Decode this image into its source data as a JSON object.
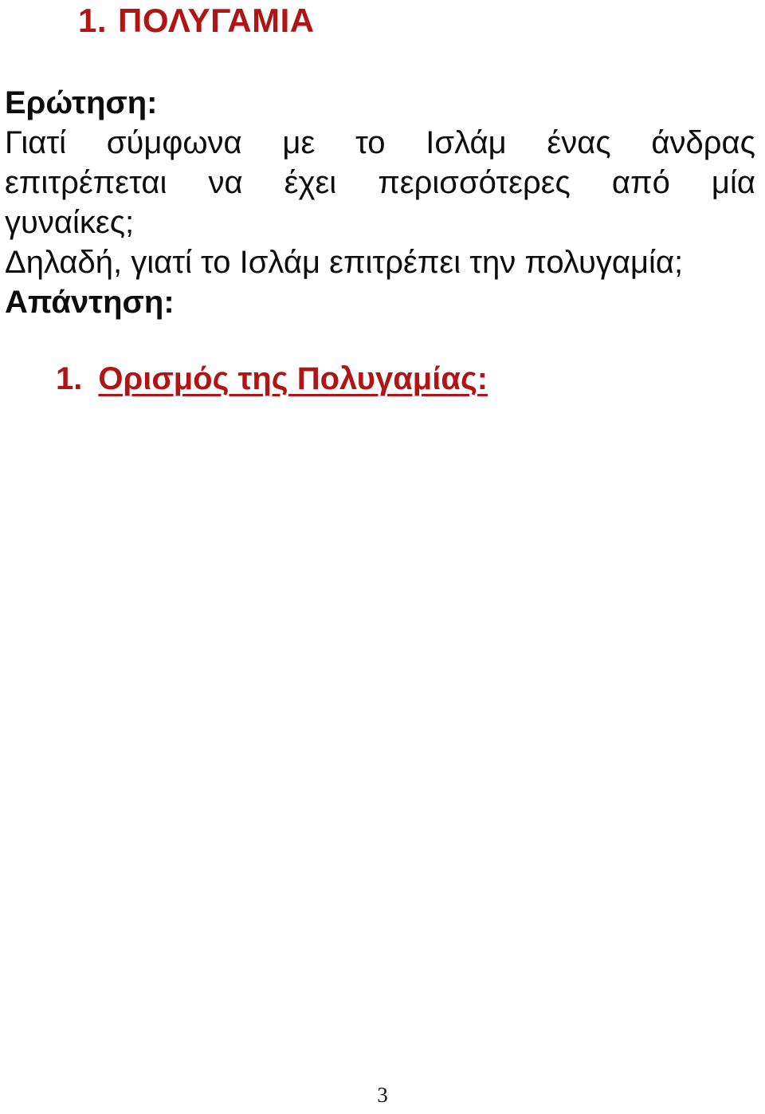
{
  "document": {
    "language": "el",
    "background_color": "#ffffff",
    "accent_color": "#b01414",
    "text_color": "#0d0d0d"
  },
  "title": {
    "number": "1.",
    "text": "ΠΟΛΥΓΑΜΙΑ",
    "color": "#b01414"
  },
  "body": {
    "question_label": "Ερώτηση:",
    "question_line_1_words": [
      "Γιατί",
      "σύμφωνα",
      "με",
      "το",
      "Ισλάμ",
      "ένας",
      "άνδρας"
    ],
    "question_line_2_words": [
      "επιτρέπεται",
      "να",
      "έχει",
      "περισσότερες",
      "από",
      "μία"
    ],
    "question_line_3": "γυναίκες;",
    "question_line_4": "Δηλαδή, γιατί το Ισλάμ επιτρέπει την πολυγαμία;",
    "answer_label": "Απάντηση:"
  },
  "numbered_item": {
    "number": "1.",
    "text": "Ορισμός της Πολυγαμίας:",
    "color": "#b01414",
    "underlined": true
  },
  "footer": {
    "page_number": "3"
  }
}
